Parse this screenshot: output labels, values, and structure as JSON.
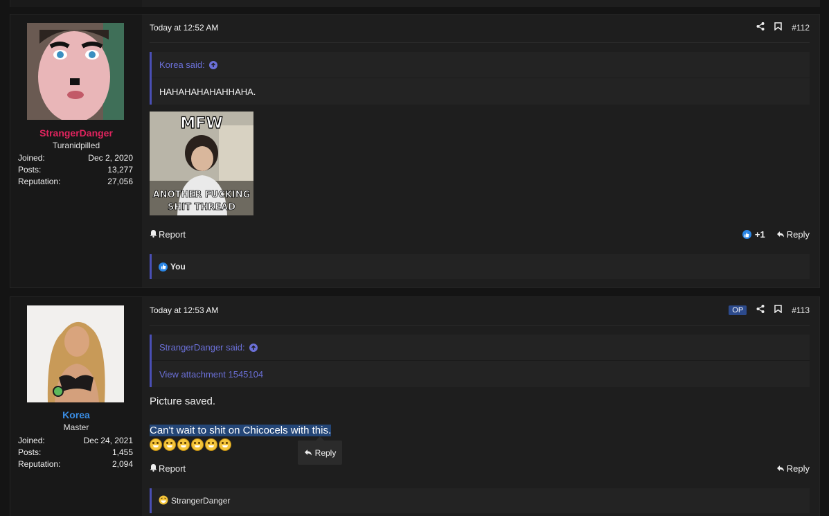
{
  "posts": [
    {
      "date": "Today at 12:52 AM",
      "post_number": "#112",
      "user": {
        "name": "StrangerDanger",
        "name_color": "#e0245e",
        "title": "Turanidpilled",
        "joined_label": "Joined:",
        "joined": "Dec 2, 2020",
        "posts_label": "Posts:",
        "posts": "13,277",
        "rep_label": "Reputation:",
        "reputation": "27,056"
      },
      "quote": {
        "author": "Korea said:",
        "text": "HAHAHAHAHAHHAHA."
      },
      "meme": {
        "top_text": "MFW",
        "bottom_text": "ANOTHER FUCKING SHIT THREAD"
      },
      "report_label": "Report",
      "like_count": "+1",
      "reply_label": "Reply",
      "reactions_label": "You"
    },
    {
      "date": "Today at 12:53 AM",
      "op_badge": "OP",
      "post_number": "#113",
      "user": {
        "name": "Korea",
        "name_color": "#3a8ee6",
        "title": "Master",
        "joined_label": "Joined:",
        "joined": "Dec 24, 2021",
        "posts_label": "Posts:",
        "posts": "1,455",
        "rep_label": "Reputation:",
        "reputation": "2,094"
      },
      "quote": {
        "author": "StrangerDanger said:",
        "text": "View attachment 1545104"
      },
      "body_line1": "Picture saved.",
      "body_line2": "Can't wait to shit on Chicocels with this.",
      "tooltip_reply": "Reply",
      "report_label": "Report",
      "reply_label": "Reply",
      "reactions_label": "StrangerDanger"
    }
  ],
  "icons": [
    "share-icon",
    "bookmark-icon",
    "bell-icon",
    "reply-arrow-icon",
    "like-icon",
    "arrow-up-circle-icon",
    "laughing-emoji-icon",
    "online-status-icon"
  ],
  "colors": {
    "quote_accent": "#4a4fb5",
    "link": "#6b70d8",
    "highlight": "#244677"
  }
}
